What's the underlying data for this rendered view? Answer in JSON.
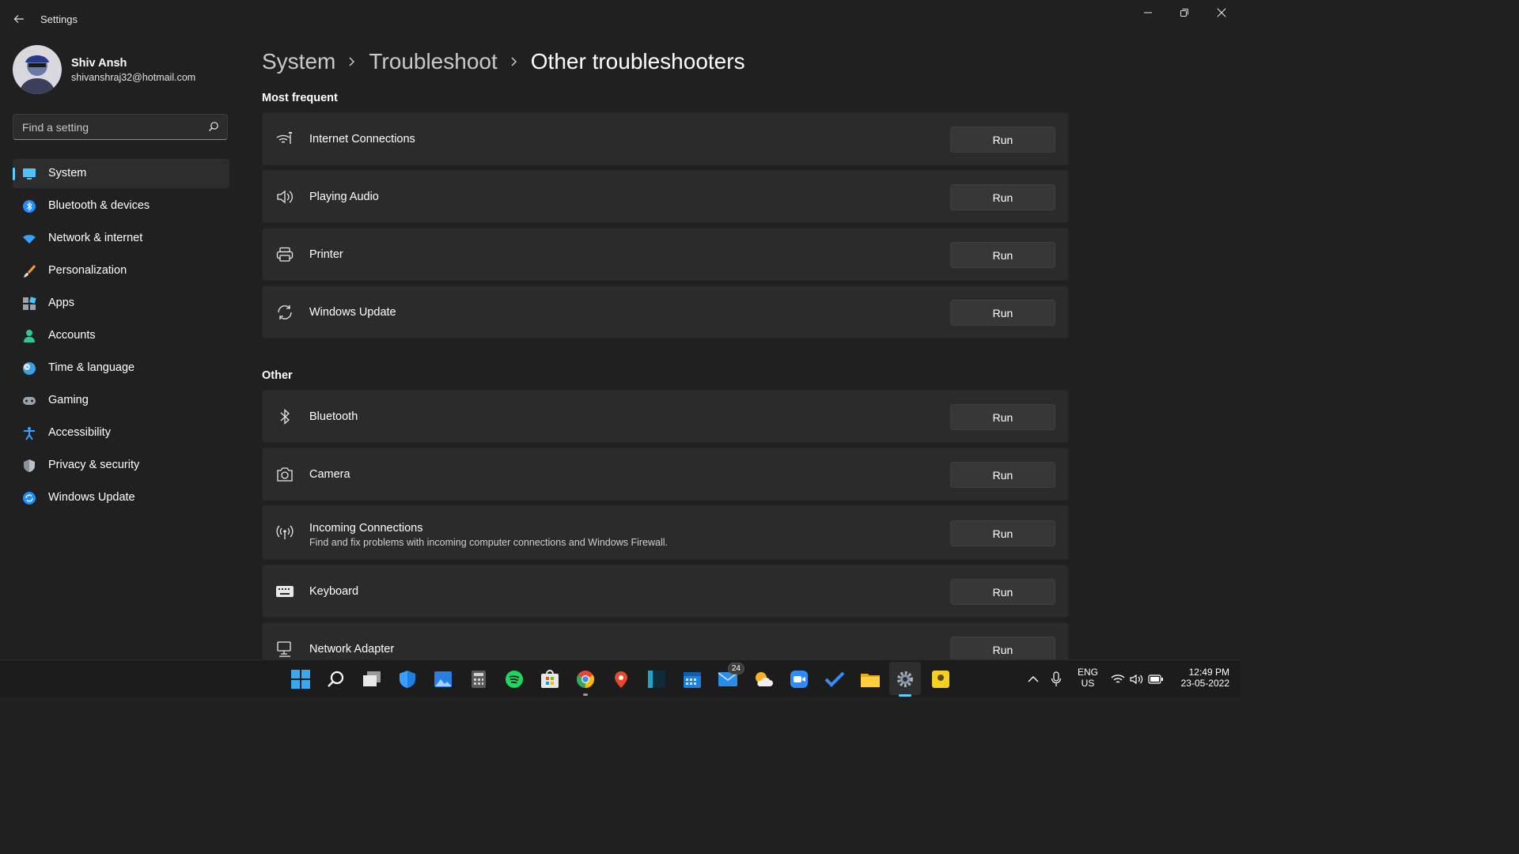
{
  "window": {
    "title": "Settings"
  },
  "profile": {
    "name": "Shiv Ansh",
    "email": "shivanshraj32@hotmail.com"
  },
  "search": {
    "placeholder": "Find a setting"
  },
  "nav": [
    {
      "label": "System",
      "icon": "monitor-icon",
      "selected": true
    },
    {
      "label": "Bluetooth & devices",
      "icon": "bluetooth-icon"
    },
    {
      "label": "Network & internet",
      "icon": "wifi-icon"
    },
    {
      "label": "Personalization",
      "icon": "brush-icon"
    },
    {
      "label": "Apps",
      "icon": "apps-icon"
    },
    {
      "label": "Accounts",
      "icon": "person-icon"
    },
    {
      "label": "Time & language",
      "icon": "globe-clock-icon"
    },
    {
      "label": "Gaming",
      "icon": "gamepad-icon"
    },
    {
      "label": "Accessibility",
      "icon": "accessibility-icon"
    },
    {
      "label": "Privacy & security",
      "icon": "shield-icon"
    },
    {
      "label": "Windows Update",
      "icon": "update-icon"
    }
  ],
  "breadcrumb": [
    "System",
    "Troubleshoot",
    "Other troubleshooters"
  ],
  "sections": {
    "most_frequent": {
      "title": "Most frequent",
      "items": [
        {
          "title": "Internet Connections",
          "icon": "wifi-signal-icon",
          "button": "Run"
        },
        {
          "title": "Playing Audio",
          "icon": "speaker-icon",
          "button": "Run"
        },
        {
          "title": "Printer",
          "icon": "printer-icon",
          "button": "Run"
        },
        {
          "title": "Windows Update",
          "icon": "sync-icon",
          "button": "Run"
        }
      ]
    },
    "other": {
      "title": "Other",
      "items": [
        {
          "title": "Bluetooth",
          "icon": "bluetooth-icon",
          "button": "Run"
        },
        {
          "title": "Camera",
          "icon": "camera-icon",
          "button": "Run"
        },
        {
          "title": "Incoming Connections",
          "description": "Find and fix problems with incoming computer connections and Windows Firewall.",
          "icon": "antenna-icon",
          "button": "Run"
        },
        {
          "title": "Keyboard",
          "icon": "keyboard-icon",
          "button": "Run"
        },
        {
          "title": "Network Adapter",
          "icon": "network-adapter-icon",
          "button": "Run"
        }
      ]
    }
  },
  "taskbar": {
    "apps": [
      "start",
      "search",
      "task-view",
      "defender",
      "photos",
      "calculator",
      "spotify",
      "store",
      "chrome",
      "maps",
      "app-dark",
      "calendar",
      "mail",
      "weather",
      "zoom",
      "todo",
      "file-explorer",
      "settings",
      "player"
    ],
    "mail_badge": "24",
    "tray": {
      "lang_top": "ENG",
      "lang_bottom": "US",
      "time": "12:49 PM",
      "date": "23-05-2022"
    }
  },
  "colors": {
    "background": "#202020",
    "card": "#2b2b2b",
    "button": "#373737",
    "accent": "#60cdff"
  }
}
